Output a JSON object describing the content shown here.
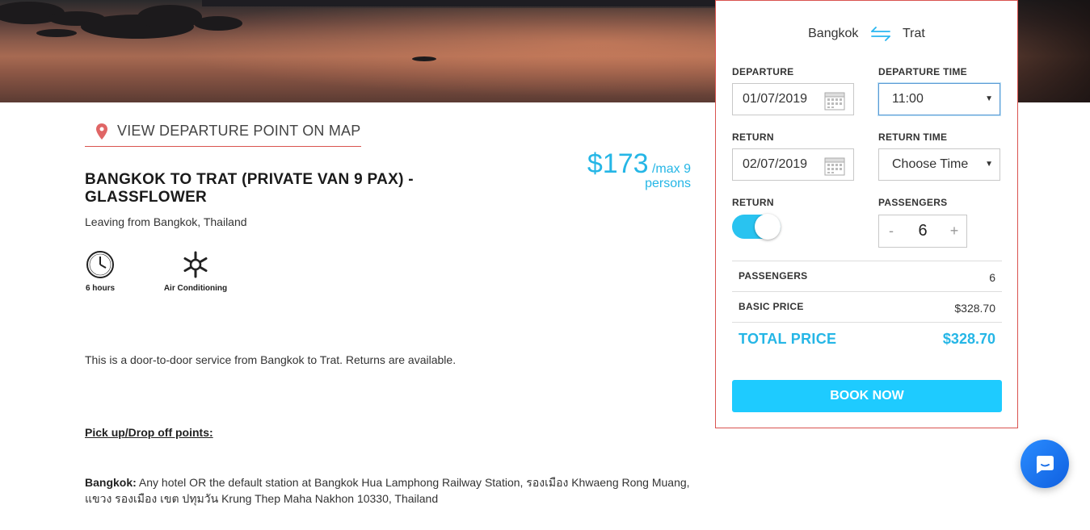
{
  "map_link": {
    "label": "VIEW DEPARTURE POINT ON MAP"
  },
  "listing": {
    "title": "BANGKOK TO TRAT (PRIVATE VAN 9 PAX) - GLASSFLOWER",
    "subtitle": "Leaving from Bangkok, Thailand",
    "price": "$173",
    "price_unit": "/max 9",
    "price_unit2": "persons",
    "features": [
      {
        "icon": "clock-icon",
        "label": "6 hours"
      },
      {
        "icon": "snowflake-icon",
        "label": "Air Conditioning"
      }
    ],
    "description": "This is a door-to-door service from Bangkok to Trat. Returns are available.",
    "pickup_heading": "Pick up/Drop off points:",
    "bangkok_label": "Bangkok:",
    "bangkok_text": " Any hotel OR the default station at Bangkok Hua Lamphong Railway Station, รองเมือง Khwaeng Rong Muang, แขวง รองเมือง เขต ปทุมวัน Krung Thep Maha Nakhon 10330, Thailand"
  },
  "booking": {
    "from": "Bangkok",
    "to": "Trat",
    "departure_label": "DEPARTURE",
    "departure_date": "01/07/2019",
    "departure_time_label": "DEPARTURE TIME",
    "departure_time": "11:00",
    "return_label": "RETURN",
    "return_date": "02/07/2019",
    "return_time_label": "RETURN TIME",
    "return_time": "Choose Time",
    "return_toggle_label": "RETURN",
    "return_toggle_on": true,
    "passengers_label": "PASSENGERS",
    "passengers_minus": "-",
    "passengers_plus": "+",
    "passengers": "6",
    "summary": {
      "passengers_label": "PASSENGERS",
      "passengers_value": "6",
      "basic_label": "BASIC PRICE",
      "basic_value": "$328.70",
      "total_label": "TOTAL PRICE",
      "total_value": "$328.70"
    },
    "book_label": "BOOK NOW"
  },
  "colors": {
    "accent": "#25b6e6",
    "button": "#1ecbff",
    "border_red": "#d9534f"
  }
}
